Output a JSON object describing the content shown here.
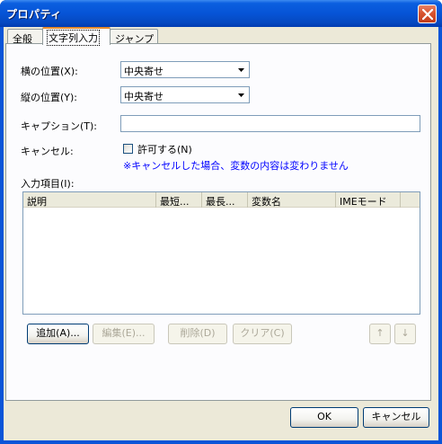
{
  "window": {
    "title": "プロパティ"
  },
  "tabs": [
    {
      "label": "全般"
    },
    {
      "label": "文字列入力"
    },
    {
      "label": "ジャンプ"
    }
  ],
  "form": {
    "h_position": {
      "label": "横の位置(X):",
      "value": "中央寄せ"
    },
    "v_position": {
      "label": "縦の位置(Y):",
      "value": "中央寄せ"
    },
    "caption": {
      "label": "キャプション(T):",
      "value": ""
    },
    "cancel": {
      "label": "キャンセル:",
      "checkbox_label": "許可する(N)",
      "checked": false,
      "note": "※キャンセルした場合、変数の内容は変わりません"
    },
    "items_label": "入力項目(I):"
  },
  "list": {
    "columns": [
      "説明",
      "最短...",
      "最長...",
      "変数名",
      "IMEモード"
    ],
    "rows": []
  },
  "buttons": {
    "add": "追加(A)...",
    "edit": "編集(E)...",
    "delete": "削除(D)",
    "clear": "クリア(C)",
    "up": "↑",
    "down": "↓",
    "ok": "OK",
    "cancel": "キャンセル"
  }
}
